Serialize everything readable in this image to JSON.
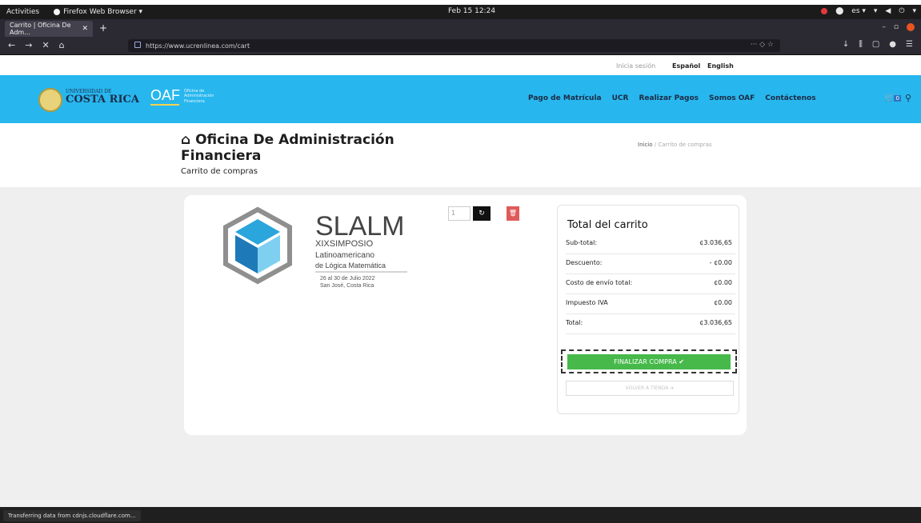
{
  "gnome": {
    "activities": "Activities",
    "app_menu": "Firefox Web Browser ▾",
    "clock": "Feb 15 12:24",
    "tray_lang": "es ▾",
    "tray_power": "▾"
  },
  "browser": {
    "tab_title": "Carrito | Oficina De Adm...",
    "url_display": "https://www.ucrenlinea.com/cart",
    "status_text": "Transferring data from cdnjs.cloudflare.com..."
  },
  "lang_bar": {
    "login": "Inicia sesión",
    "spanish": "Español",
    "english": "English"
  },
  "header": {
    "logo_line1": "UNIVERSIDAD DE",
    "logo_line2": "COSTA RICA",
    "oaf": "OAF",
    "oaf_sub1": "Oficina de",
    "oaf_sub2": "Administración",
    "oaf_sub3": "Financiera",
    "menu": [
      {
        "label": "Pago de Matrícula"
      },
      {
        "label": "UCR"
      },
      {
        "label": "Realizar Pagos"
      },
      {
        "label": "Somos OAF"
      },
      {
        "label": "Contáctenos"
      }
    ],
    "cart_count": "0"
  },
  "title": {
    "heading": "Oficina De Administración Financiera",
    "subtitle": "Carrito de compras",
    "breadcrumb_home": "Inicio",
    "breadcrumb_current": "Carrito de compras"
  },
  "product": {
    "logo_name": "SLALM",
    "logo_line1": "XIX",
    "logo_line1b": "SIMPOSIO",
    "logo_line2": "Latinoamericano",
    "logo_line3": "de Lógica Matemática",
    "logo_line4": "26 al 30 de Julio 2022",
    "logo_line5": "San José, Costa Rica",
    "quantity": "1"
  },
  "totals": {
    "title": "Total del carrito",
    "rows": [
      {
        "label": "Sub-total:",
        "value": "¢3.036,65"
      },
      {
        "label": "Descuento:",
        "value": "- ¢0.00"
      },
      {
        "label": "Costo de envío total:",
        "value": "¢0.00"
      },
      {
        "label": "Impuesto IVA",
        "value": "¢0.00"
      },
      {
        "label": "Total:",
        "value": "¢3.036,65"
      }
    ],
    "finalize_label": "FINALIZAR COMPRA ✔",
    "back_label": "VOLVER A TIENDA ➔"
  },
  "colors": {
    "header_blue": "#27b7ee",
    "finalize_green": "#46b94a",
    "remove_red": "#e05a5a"
  }
}
